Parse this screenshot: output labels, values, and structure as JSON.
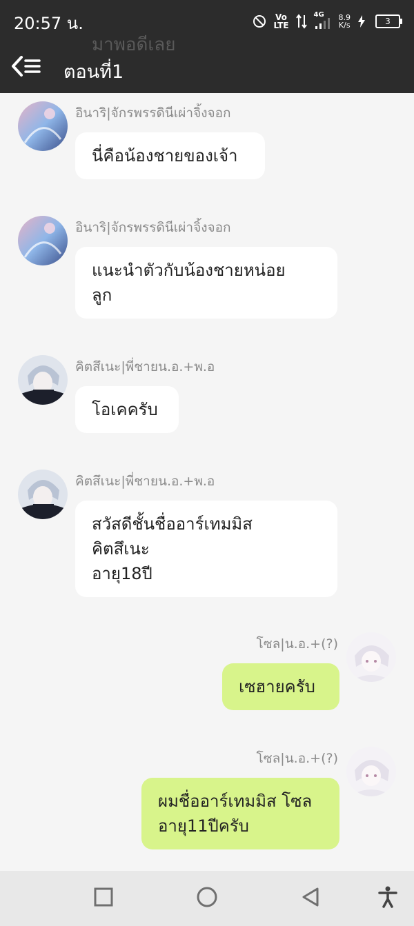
{
  "status_bar": {
    "time": "20:57 น.",
    "network_volte_top": "Vo",
    "network_volte_bottom": "LTE",
    "network_4g": "4G",
    "speed_value": "8.9",
    "speed_unit": "K/s",
    "battery": "3"
  },
  "header": {
    "ghost_text": "มาพอดีเลย",
    "title": "ตอนที่1"
  },
  "messages": [
    {
      "sender": "อินาริ|จักรพรรดินีเผ่าจิ้งจอก",
      "lines": [
        "นี่คือน้องชายของเจ้า"
      ]
    },
    {
      "sender": "อินาริ|จักรพรรดินีเผ่าจิ้งจอก",
      "lines": [
        "แนะนำตัวกับน้องชายหน่อย",
        "ลูก"
      ]
    },
    {
      "sender": "คิตสึเนะ|พี่ชายน.อ.+พ.อ",
      "lines": [
        "โอเคครับ"
      ]
    },
    {
      "sender": "คิตสึเนะ|พี่ชายน.อ.+พ.อ",
      "lines": [
        "สวัสดีชั้นชื่ออาร์เทมมิส",
        "คิตสึเนะ",
        "อายุ18ปี"
      ]
    },
    {
      "sender": "โซล|น.อ.+(?)",
      "lines": [
        "เซฮายครับ"
      ]
    },
    {
      "sender": "โซล|น.อ.+(?)",
      "lines": [
        "ผมชื่ออาร์เทมมิส โซล",
        "อายุ11ปีครับ"
      ]
    }
  ],
  "colors": {
    "header_bg": "#2c2c2c",
    "page_bg": "#f5f5f5",
    "bubble_left": "#ffffff",
    "bubble_right": "#d8f48b",
    "sender_text": "#8a8a8a",
    "navbar_bg": "#e8e8e8"
  },
  "icons": {
    "back": "back-menu-icon",
    "dnd": "do-not-disturb-icon",
    "nav_recent": "recent-apps-icon",
    "nav_home": "home-icon",
    "nav_back": "back-triangle-icon",
    "nav_accessibility": "accessibility-icon"
  }
}
